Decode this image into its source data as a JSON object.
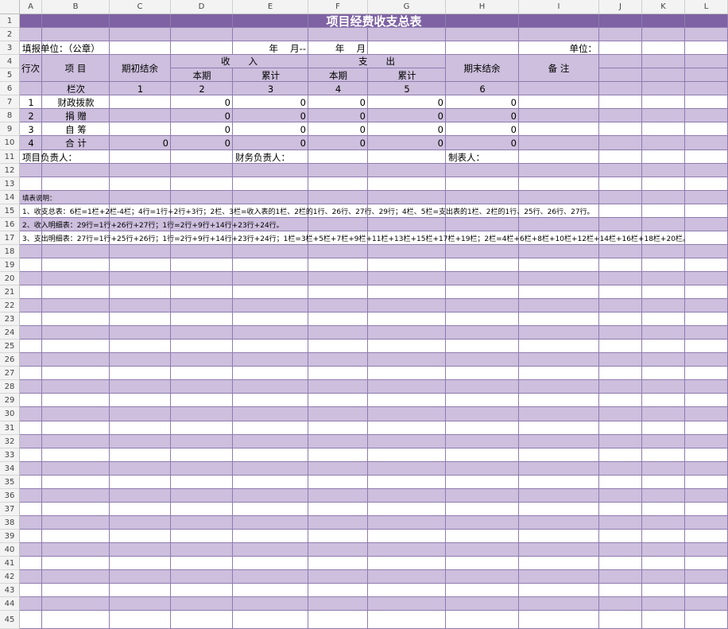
{
  "columns": [
    "A",
    "B",
    "C",
    "D",
    "E",
    "F",
    "G",
    "H",
    "I",
    "J",
    "K",
    "L"
  ],
  "rows": [
    "1",
    "2",
    "3",
    "4",
    "5",
    "6",
    "7",
    "8",
    "9",
    "10",
    "11",
    "12",
    "13",
    "14",
    "15",
    "16",
    "17",
    "18",
    "19",
    "20",
    "21",
    "22",
    "23",
    "24",
    "25",
    "26",
    "27",
    "28",
    "29",
    "30",
    "31",
    "32",
    "33",
    "34",
    "35",
    "36",
    "37",
    "38",
    "39",
    "40",
    "41",
    "42",
    "43",
    "44",
    "45"
  ],
  "colors": {
    "band": "#cdbfdd",
    "title_bg": "#7e62a3",
    "grid": "#8f7bb0",
    "header_bg": "#f3f3f3"
  },
  "sheet": {
    "title": "项目经费收支总表",
    "fill_unit": "填报单位：（公章）",
    "year_month_from": "年　 月--",
    "year_month_to": "年　 月",
    "unit": "单位：",
    "header": {
      "row_no": "行次",
      "item": "项  目",
      "opening_balance": "期初结余",
      "income": "收　　入",
      "expense": "支　　出",
      "current_period_1": "本期",
      "cumulative_1": "累计",
      "current_period_2": "本期",
      "cumulative_2": "累计",
      "closing_balance": "期末结余",
      "remarks": "备  注"
    },
    "column_numbers": {
      "label": "栏次",
      "n1": "1",
      "n2": "2",
      "n3": "3",
      "n4": "4",
      "n5": "5",
      "n6": "6"
    },
    "data_rows": [
      {
        "no": "1",
        "item": "财政拨款",
        "opening": "",
        "inc_cur": "0",
        "inc_cum": "0",
        "exp_cur": "0",
        "exp_cum": "0",
        "closing": "0"
      },
      {
        "no": "2",
        "item": "捐  赠",
        "opening": "",
        "inc_cur": "0",
        "inc_cum": "0",
        "exp_cur": "0",
        "exp_cum": "0",
        "closing": "0"
      },
      {
        "no": "3",
        "item": "自  筹",
        "opening": "",
        "inc_cur": "0",
        "inc_cum": "0",
        "exp_cur": "0",
        "exp_cum": "0",
        "closing": "0"
      },
      {
        "no": "4",
        "item": "合  计",
        "opening": "0",
        "inc_cur": "0",
        "inc_cum": "0",
        "exp_cur": "0",
        "exp_cum": "0",
        "closing": "0"
      }
    ],
    "signatures": {
      "project_leader": "项目负责人：",
      "finance_leader": "财务负责人：",
      "preparer": "制表人："
    },
    "notes": {
      "title": "填表说明：",
      "line1": "1、收支总表：6栏=1栏+2栏-4栏；4行=1行+2行+3行；2栏、3栏=收入表的1栏、2栏的1行、26行、27行、29行；4栏、5栏=支出表的1栏、2栏的1行、25行、26行、27行。",
      "line2": "2、收入明细表：29行=1行+26行+27行；1行=2行+9行+14行+23行+24行。",
      "line3": "3、支出明细表：27行=1行+25行+26行；1行=2行+9行+14行+23行+24行；1栏=3栏+5栏+7栏+9栏+11栏+13栏+15栏+17栏+19栏；2栏=4栏+6栏+8栏+10栏+12栏+14栏+16栏+18栏+20栏。"
    }
  }
}
